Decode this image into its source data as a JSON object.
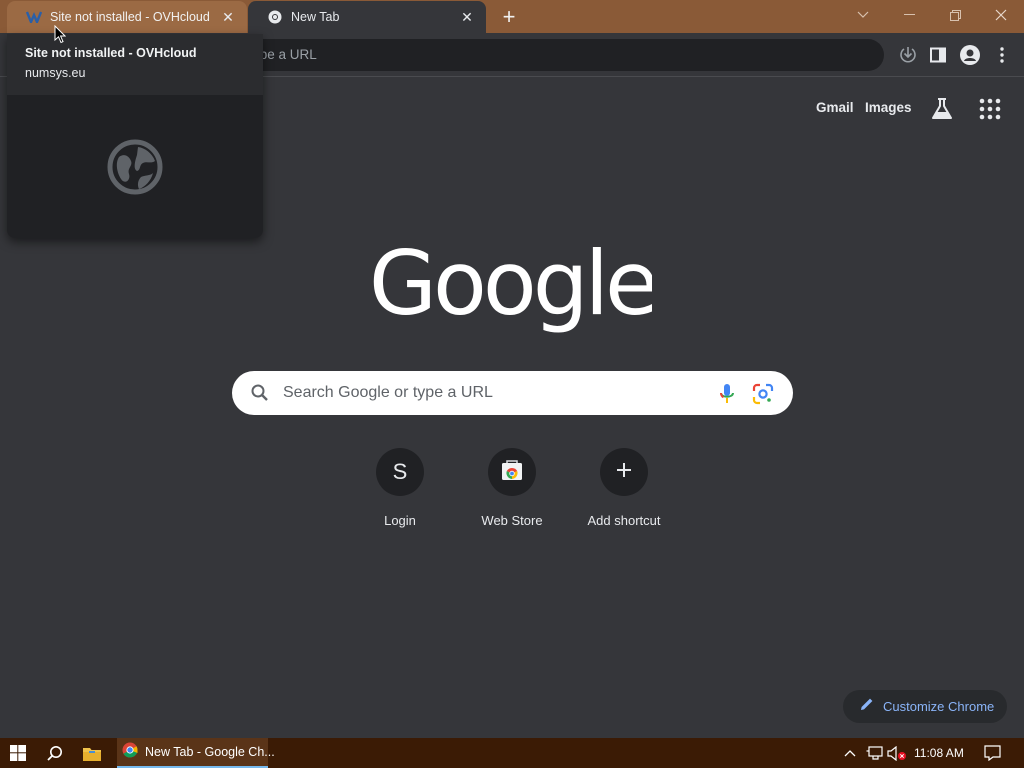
{
  "tabs": [
    {
      "title": "Site not installed - OVHcloud",
      "favicon": "ovhcloud-logo-icon",
      "active": false
    },
    {
      "title": "New Tab",
      "favicon": "chrome-icon",
      "active": true
    }
  ],
  "window_controls": {
    "tab_search": "chevron-down-icon",
    "minimize": "minimize-icon",
    "restore": "restore-icon",
    "close": "close-icon"
  },
  "omnibox": {
    "placeholder_visible": "ype a URL"
  },
  "hover_card": {
    "title": "Site not installed - OVHcloud",
    "domain": "numsys.eu",
    "preview_icon": "globe-icon"
  },
  "ntp": {
    "top_links": {
      "gmail": "Gmail",
      "images": "Images"
    },
    "search": {
      "placeholder": "Search Google or type a URL"
    },
    "shortcuts": [
      {
        "label": "Login",
        "letter": "S"
      },
      {
        "label": "Web Store",
        "icon": "web-store-icon"
      },
      {
        "label": "Add shortcut",
        "icon": "plus-icon"
      }
    ],
    "customize_label": "Customize Chrome"
  },
  "taskbar": {
    "chrome_task_label": "New Tab - Google Ch...",
    "clock": "11:08 AM"
  },
  "colors": {
    "titlebar": "#8a5a37",
    "background": "#35363a",
    "accent_link": "#8ab4f8",
    "taskbar": "#3b1b05"
  }
}
